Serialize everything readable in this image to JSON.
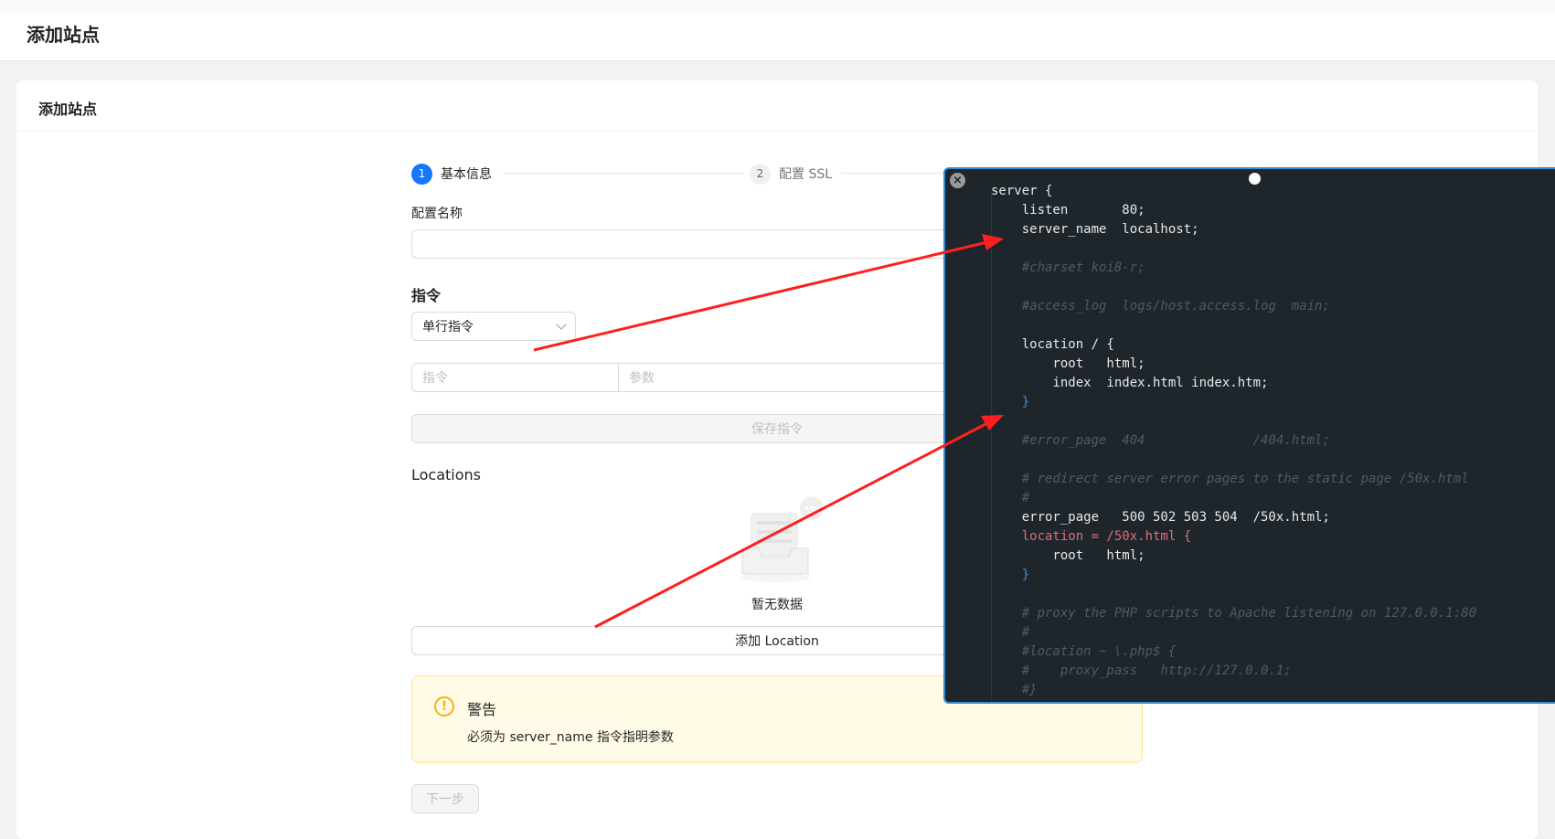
{
  "header": {
    "title": "添加站点"
  },
  "card": {
    "title": "添加站点"
  },
  "steps": [
    {
      "num": "1",
      "label": "基本信息"
    },
    {
      "num": "2",
      "label": "配置 SSL"
    }
  ],
  "form": {
    "config_name_label": "配置名称",
    "config_name_value": "",
    "directives_heading": "指令",
    "directive_type_selected": "单行指令",
    "directive_placeholder": "指令",
    "param_placeholder": "参数",
    "save_directive_label": "保存指令"
  },
  "locations": {
    "heading": "Locations",
    "empty_text": "暂无数据",
    "add_label": "添加 Location"
  },
  "alert": {
    "title": "警告",
    "icon": "!",
    "description": "必须为 server_name 指令指明参数"
  },
  "next_label": "下一步",
  "popup": {
    "close_glyph": "×",
    "code_lines": [
      "server {",
      "    listen       80;",
      "    server_name  localhost;",
      "",
      "    #charset koi8-r;",
      "",
      "    #access_log  logs/host.access.log  main;",
      "",
      "    location / {",
      "        root   html;",
      "        index  index.html index.htm;",
      "    }",
      "",
      "    #error_page  404              /404.html;",
      "",
      "    # redirect server error pages to the static page /50x.html",
      "    #",
      "    error_page   500 502 503 504  /50x.html;",
      "    location = /50x.html {",
      "        root   html;",
      "    }",
      "",
      "    # proxy the PHP scripts to Apache listening on 127.0.0.1:80",
      "    #",
      "    #location ~ \\.php$ {",
      "    #    proxy_pass   http://127.0.0.1;",
      "    #}"
    ]
  },
  "colors": {
    "primary": "#1677ff",
    "warning": "#faad14",
    "alert_bg": "#fffbe6",
    "code_bg": "#1e262c",
    "arrow": "#ff1f1f"
  }
}
